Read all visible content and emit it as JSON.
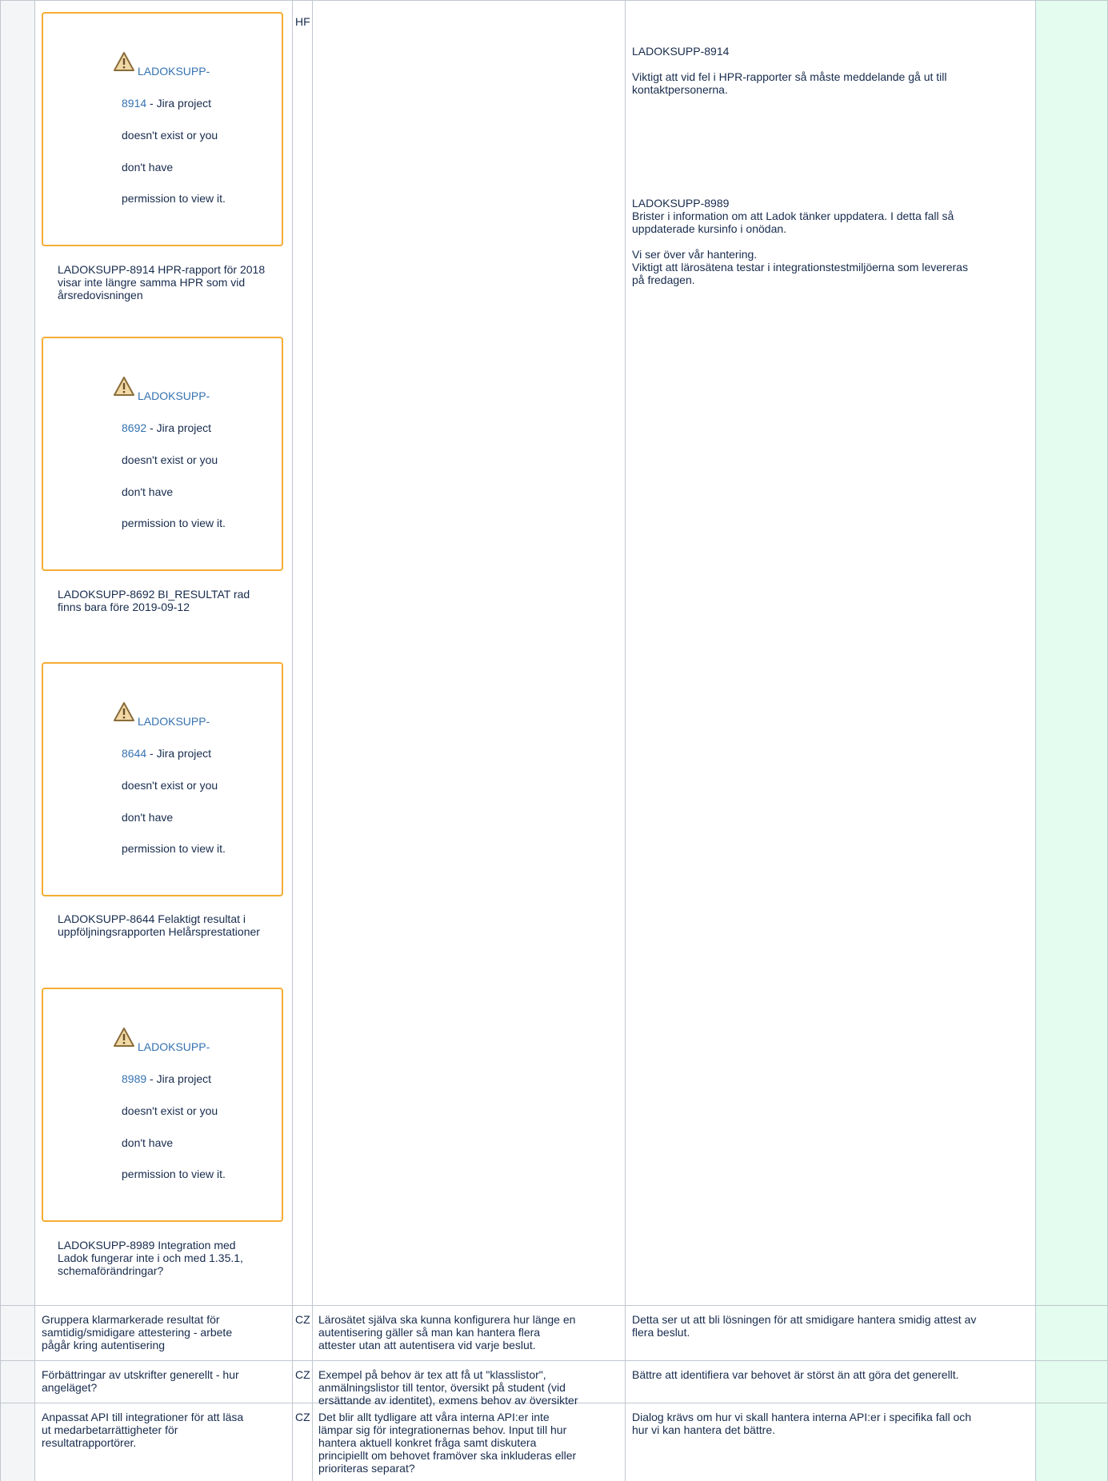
{
  "jira_boxes": [
    {
      "key_part1": "LADOKSUPP-",
      "key_part2": "8914",
      "rest1": " - Jira project",
      "rest2": "doesn't exist or you",
      "rest3": "don't have",
      "rest4": "permission to view it."
    },
    {
      "key_part1": "LADOKSUPP-",
      "key_part2": "8692",
      "rest1": " - Jira project",
      "rest2": "doesn't exist or you",
      "rest3": "don't have",
      "rest4": "permission to view it."
    },
    {
      "key_part1": "LADOKSUPP-",
      "key_part2": "8644",
      "rest1": " - Jira project",
      "rest2": "doesn't exist or you",
      "rest3": "don't have",
      "rest4": "permission to view it."
    },
    {
      "key_part1": "LADOKSUPP-",
      "key_part2": "8989",
      "rest1": " - Jira project",
      "rest2": "doesn't exist or you",
      "rest3": "don't have",
      "rest4": "permission to view it."
    }
  ],
  "issue_notes": [
    {
      "l1": "LADOKSUPP-8914 HPR-rapport för 2018",
      "l2": "visar inte längre samma HPR som vid",
      "l3": "årsredovisningen"
    },
    {
      "l1": "LADOKSUPP-8692 BI_RESULTAT rad",
      "l2": "finns bara före 2019-09-12",
      "l3": ""
    },
    {
      "l1": "LADOKSUPP-8644 Felaktigt resultat i",
      "l2": "uppföljningsrapporten Helårsprestationer",
      "l3": ""
    },
    {
      "l1": "LADOKSUPP-8989 Integration med",
      "l2": "Ladok fungerar inte i och med 1.35.1,",
      "l3": "schemaförändringar?"
    }
  ],
  "first_row": {
    "owner": "HF",
    "comments": {
      "c1_title": "LADOKSUPP-8914",
      "c1_l1": "Viktigt att vid fel i HPR-rapporter så måste meddelande gå ut till",
      "c1_l2": "kontaktpersonerna.",
      "c2_title": "LADOKSUPP-8989",
      "c2_l1": "Brister i information om att Ladok tänker uppdatera. I detta fall så",
      "c2_l2": "uppdaterade kursinfo i onödan.",
      "c2_l3": "Vi ser över vår hantering.",
      "c2_l4": "Viktigt att lärosätena testar i integrationstestmiljöerna som levereras",
      "c2_l5": "på fredagen."
    }
  },
  "rows": [
    {
      "topic": [
        "Gruppera klarmarkerade resultat för",
        "samtidig/smidigare attestering - arbete",
        "pågår kring autentisering"
      ],
      "owner": "CZ",
      "desc": [
        "Lärosätet själva ska kunna konfigurera hur länge en",
        "autentisering gäller så man kan hantera flera",
        "attester utan att autentisera vid varje beslut."
      ],
      "comment": [
        "Detta ser ut att bli lösningen för att smidigare hantera smidig attest av",
        "flera beslut."
      ]
    },
    {
      "topic": [
        "Förbättringar av utskrifter generellt - hur",
        "angeläget?"
      ],
      "owner": "CZ",
      "desc": [
        "Exempel på behov är tex att få ut \"klasslistor\",",
        "anmälningslistor till tentor, översikt på student (vid",
        "ersättande av identitet), exmens behov av översikter"
      ],
      "comment": [
        "Bättre att identifiera var behovet är störst än att göra det generellt."
      ]
    },
    {
      "topic": [
        "Anpassat API till integrationer för att läsa",
        "ut medarbetarrättigheter för",
        "resultatrapportörer."
      ],
      "owner": "CZ",
      "desc": [
        "Det blir allt tydligare att våra interna API:er inte",
        "lämpar sig för integrationernas behov. Input till hur",
        "hantera aktuell konkret fråga samt diskutera",
        "principiellt om behovet framöver ska inkluderas eller",
        "prioriteras separat?"
      ],
      "comment": [
        "Dialog krävs om hur vi skall hantera interna API:er i specifika fall och",
        "hur vi kan hantera det bättre."
      ]
    }
  ],
  "colors": {
    "jira_border": "#f6ad33",
    "link": "#3572b0",
    "grid": "#c1c7d0",
    "last_col": "#e3fcef"
  }
}
